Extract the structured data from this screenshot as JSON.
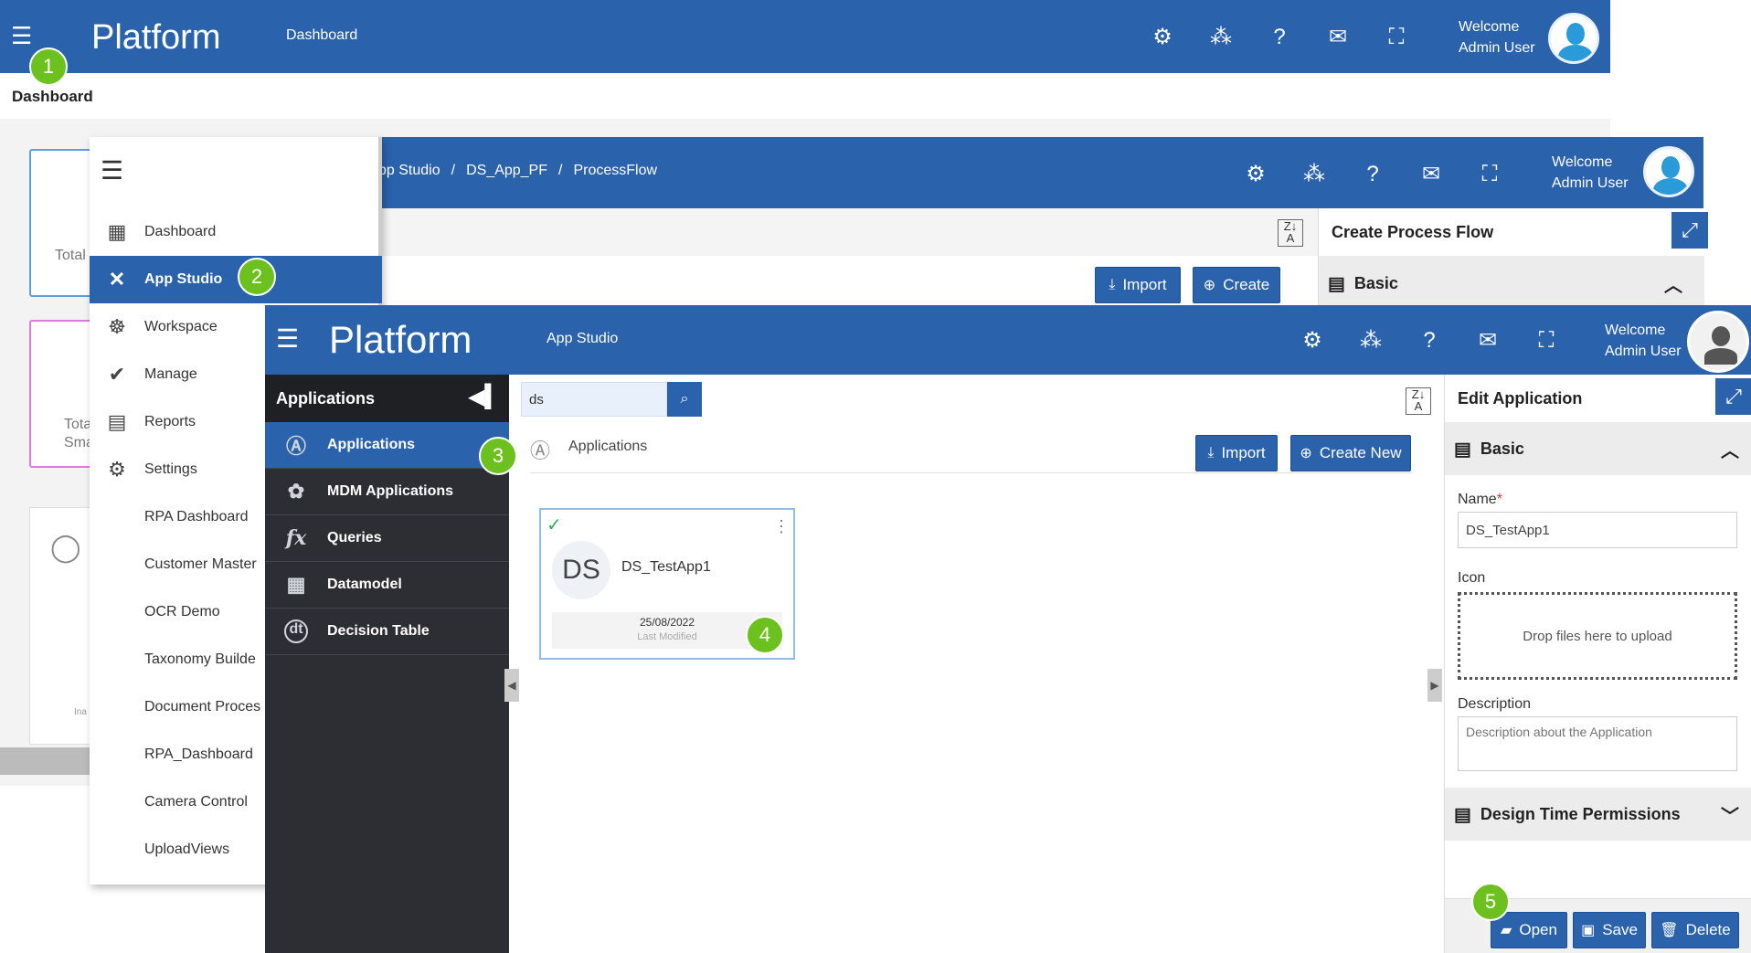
{
  "layer1": {
    "brand": "Platform",
    "nav_title": "Dashboard",
    "page_title": "Dashboard",
    "welcome_line1": "Welcome",
    "welcome_line2": "Admin User",
    "card_total": "Total",
    "card_total2": "Tota",
    "card_small": "Sma",
    "card_tiny": "Ina"
  },
  "menu": {
    "items": [
      {
        "label": "Dashboard",
        "icon": "dashboard-icon"
      },
      {
        "label": "App Studio",
        "icon": "tools-icon"
      },
      {
        "label": "Workspace",
        "icon": "workspace-icon"
      },
      {
        "label": "Manage",
        "icon": "manage-icon"
      },
      {
        "label": "Reports",
        "icon": "reports-icon"
      },
      {
        "label": "Settings",
        "icon": "settings-icon"
      },
      {
        "label": "RPA Dashboard",
        "icon": ""
      },
      {
        "label": "Customer Master",
        "icon": ""
      },
      {
        "label": "OCR Demo",
        "icon": ""
      },
      {
        "label": "Taxonomy Builde",
        "icon": ""
      },
      {
        "label": "Document Proces",
        "icon": ""
      },
      {
        "label": "RPA_Dashboard",
        "icon": ""
      },
      {
        "label": "Camera Control",
        "icon": ""
      },
      {
        "label": "UploadViews",
        "icon": ""
      }
    ]
  },
  "layer2": {
    "breadcrumb_1": "pp Studio",
    "breadcrumb_sep": "/",
    "breadcrumb_2": "DS_App_PF",
    "breadcrumb_3": "ProcessFlow",
    "welcome_line1": "Welcome",
    "welcome_line2": "Admin User",
    "import_label": "Import",
    "create_label": "Create",
    "panel_title": "Create Process Flow",
    "section_basic": "Basic"
  },
  "layer3": {
    "brand": "Platform",
    "nav_title": "App Studio",
    "welcome_line1": "Welcome",
    "welcome_line2": "Admin User",
    "sidebar_title": "Applications",
    "sidebar_items": [
      {
        "label": "Applications",
        "icon": "applications-icon"
      },
      {
        "label": "MDM Applications",
        "icon": "mdm-icon"
      },
      {
        "label": "Queries",
        "icon": "fx-icon"
      },
      {
        "label": "Datamodel",
        "icon": "table-icon"
      },
      {
        "label": "Decision Table",
        "icon": "dt-icon"
      }
    ],
    "search_value": "ds",
    "section_label": "Applications",
    "import_label": "Import",
    "create_new_label": "Create New",
    "app_card": {
      "initials": "DS",
      "name": "DS_TestApp1",
      "date": "25/08/2022",
      "date_caption": "Last Modified"
    },
    "edit_panel": {
      "title": "Edit Application",
      "section_basic": "Basic",
      "name_label": "Name",
      "required_mark": "*",
      "name_value": "DS_TestApp1",
      "icon_label": "Icon",
      "drop_text": "Drop files here to upload",
      "description_label": "Description",
      "description_placeholder": "Description about the Application",
      "permissions_label": "Design Time Permissions",
      "open_label": "Open",
      "save_label": "Save",
      "delete_label": "Delete"
    }
  },
  "badges": [
    "1",
    "2",
    "3",
    "4",
    "5"
  ],
  "colors": {
    "header_blue": "#2a62ab",
    "sidebar_dark": "#2d2e34",
    "badge_green": "#6cc11e"
  }
}
